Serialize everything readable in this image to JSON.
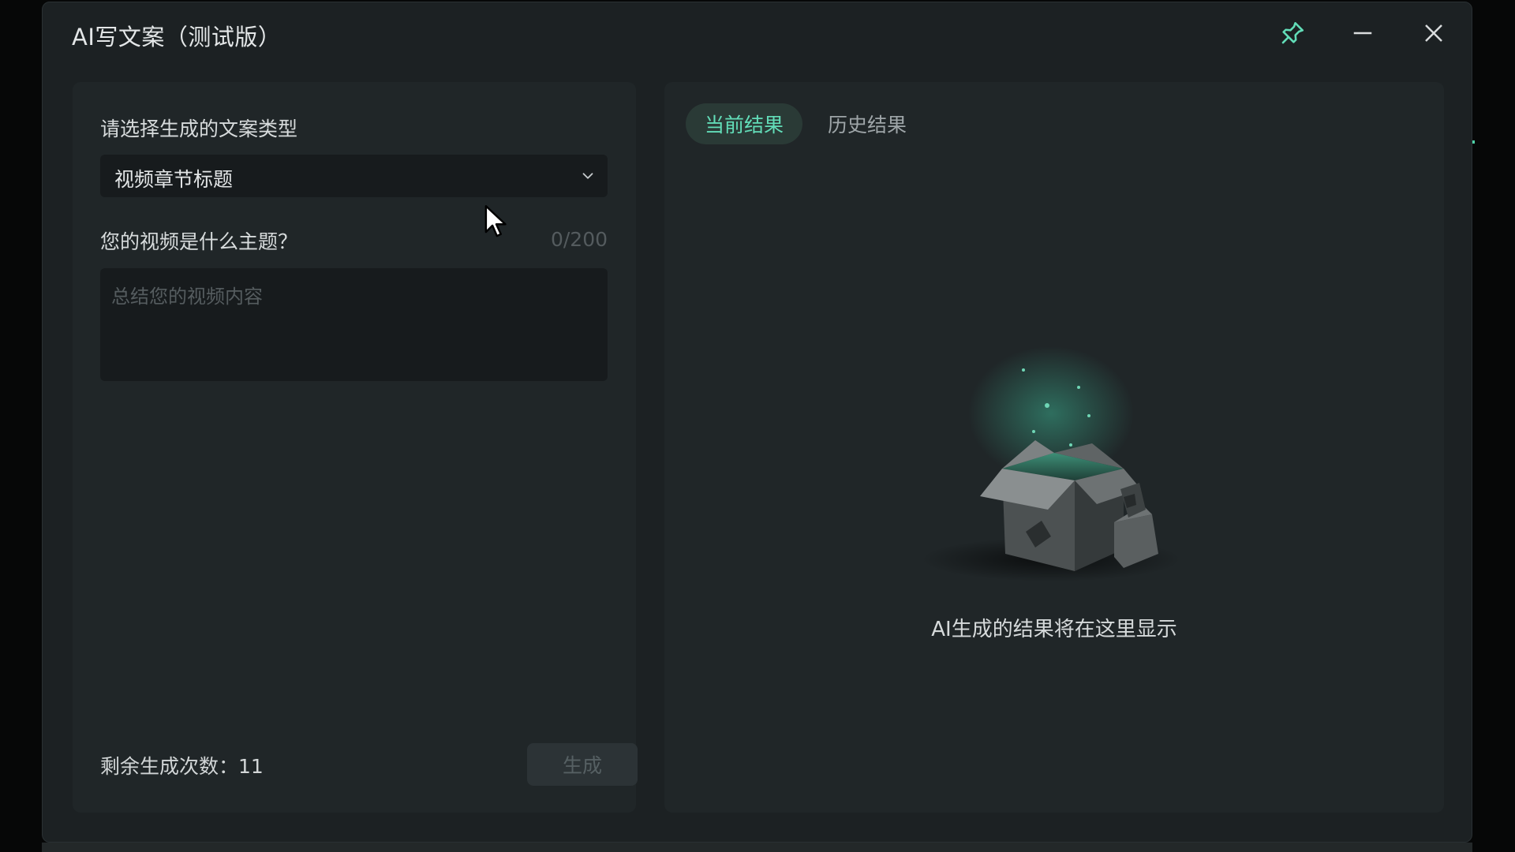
{
  "window": {
    "title": "AI写文案（测试版）",
    "controls": {
      "pin_icon": "pin-icon",
      "minimize_icon": "minimize-icon",
      "close_icon": "close-icon"
    }
  },
  "form": {
    "type_label": "请选择生成的文案类型",
    "type_selected": "视频章节标题",
    "topic_label": "您的视频是什么主题？",
    "char_counter": "0/200",
    "topic_placeholder": "总结您的视频内容",
    "topic_value": "",
    "remaining_label": "剩余生成次数：11",
    "generate_label": "生成"
  },
  "results": {
    "tabs": [
      {
        "label": "当前结果",
        "active": true
      },
      {
        "label": "历史结果",
        "active": false
      }
    ],
    "empty_message": "AI生成的结果将在这里显示"
  },
  "colors": {
    "accent": "#62ddb8",
    "window_bg": "#1c2123",
    "panel_bg": "#202628",
    "input_bg": "#171b1d",
    "disabled_button_bg": "#2c3336"
  }
}
